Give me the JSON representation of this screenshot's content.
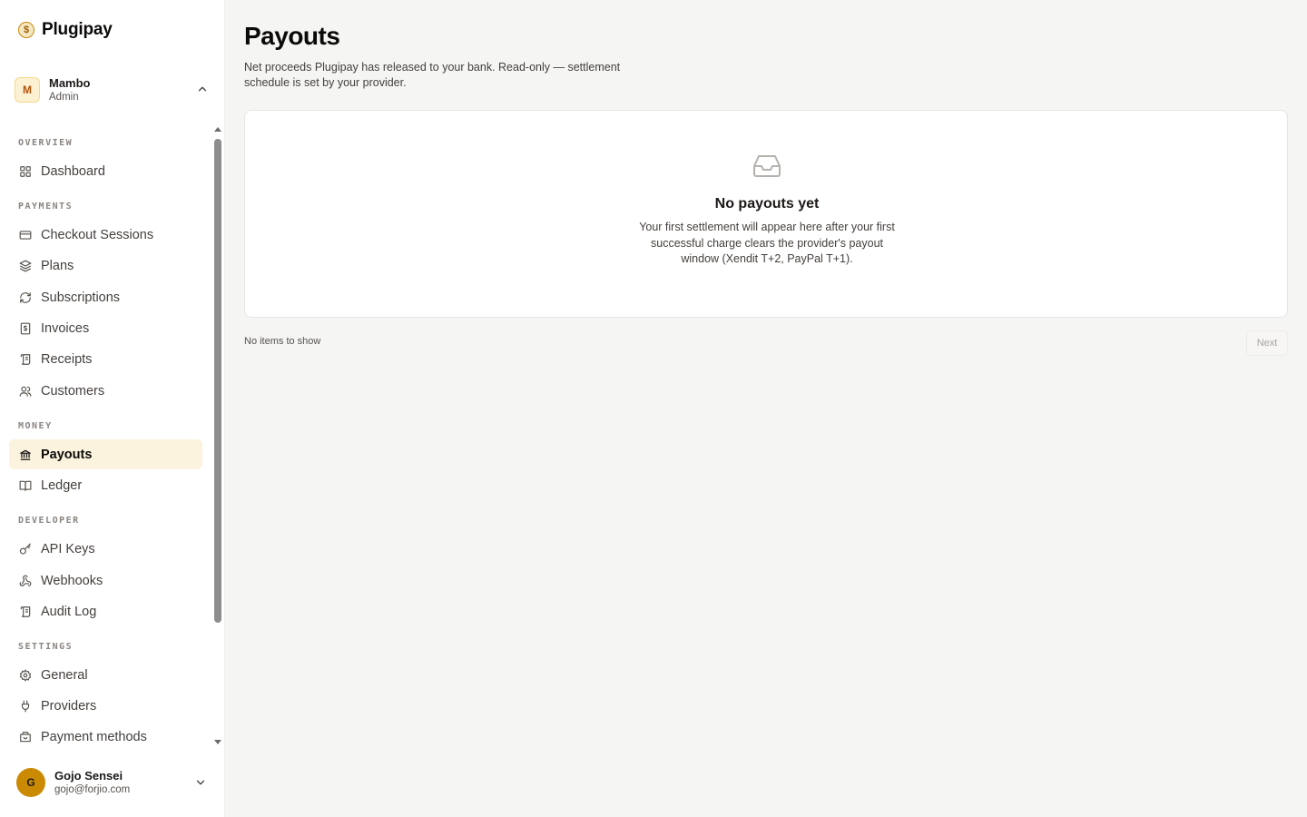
{
  "brand": {
    "name": "Plugipay",
    "logo_icon": "dollar-coin-icon"
  },
  "org": {
    "initial": "M",
    "name": "Mambo",
    "role": "Admin"
  },
  "nav": {
    "sections": [
      {
        "label": "OVERVIEW",
        "items": [
          {
            "label": "Dashboard",
            "icon": "grid-icon"
          }
        ]
      },
      {
        "label": "PAYMENTS",
        "items": [
          {
            "label": "Checkout Sessions",
            "icon": "credit-card-icon"
          },
          {
            "label": "Plans",
            "icon": "layers-icon"
          },
          {
            "label": "Subscriptions",
            "icon": "refresh-icon"
          },
          {
            "label": "Invoices",
            "icon": "invoice-dollar-icon"
          },
          {
            "label": "Receipts",
            "icon": "receipt-icon"
          },
          {
            "label": "Customers",
            "icon": "users-icon"
          }
        ]
      },
      {
        "label": "MONEY",
        "items": [
          {
            "label": "Payouts",
            "icon": "bank-icon",
            "active": true
          },
          {
            "label": "Ledger",
            "icon": "book-icon"
          }
        ]
      },
      {
        "label": "DEVELOPER",
        "items": [
          {
            "label": "API Keys",
            "icon": "key-icon"
          },
          {
            "label": "Webhooks",
            "icon": "webhook-icon"
          },
          {
            "label": "Audit Log",
            "icon": "scroll-icon"
          }
        ]
      },
      {
        "label": "SETTINGS",
        "items": [
          {
            "label": "General",
            "icon": "gear-icon"
          },
          {
            "label": "Providers",
            "icon": "plug-icon"
          },
          {
            "label": "Payment methods",
            "icon": "wallet-icon"
          }
        ]
      }
    ]
  },
  "user": {
    "initial": "G",
    "name": "Gojo Sensei",
    "email": "gojo@forjio.com"
  },
  "page": {
    "title": "Payouts",
    "description": "Net proceeds Plugipay has released to your bank. Read-only — settlement schedule is set by your provider."
  },
  "empty_state": {
    "icon": "inbox-icon",
    "title": "No payouts yet",
    "description": "Your first settlement will appear here after your first successful charge clears the provider's payout window (Xendit T+2, PayPal T+1)."
  },
  "pagination": {
    "info": "No items to show",
    "next_label": "Next"
  },
  "colors": {
    "accent": "#ca8a04",
    "active_bg": "#fbf3dd",
    "page_bg": "#f5f5f4"
  }
}
